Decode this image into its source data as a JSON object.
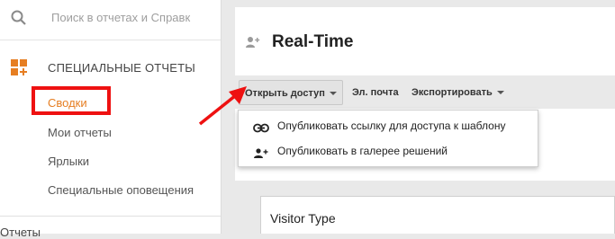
{
  "sidebar": {
    "search_placeholder": "Поиск в отчетах и Справк",
    "section_label": "СПЕЦИАЛЬНЫЕ ОТЧЕТЫ",
    "items": [
      {
        "label": "Сводки",
        "active": true
      },
      {
        "label": "Мои отчеты"
      },
      {
        "label": "Ярлыки"
      },
      {
        "label": "Специальные оповещения"
      }
    ],
    "bottom_item": "Отчеты"
  },
  "header": {
    "title": "Real-Time"
  },
  "toolbar": {
    "share_label": "Открыть доступ",
    "email_label": "Эл. почта",
    "export_label": "Экспортировать"
  },
  "dropdown": {
    "items": [
      {
        "label": "Опубликовать ссылку для доступа к шаблону",
        "icon": "link-icon"
      },
      {
        "label": "Опубликовать в галерее решений",
        "icon": "add-person-icon"
      }
    ]
  },
  "content": {
    "visitor_title": "Visitor Type"
  },
  "colors": {
    "accent": "#e67e22",
    "highlight": "#ee1111"
  }
}
